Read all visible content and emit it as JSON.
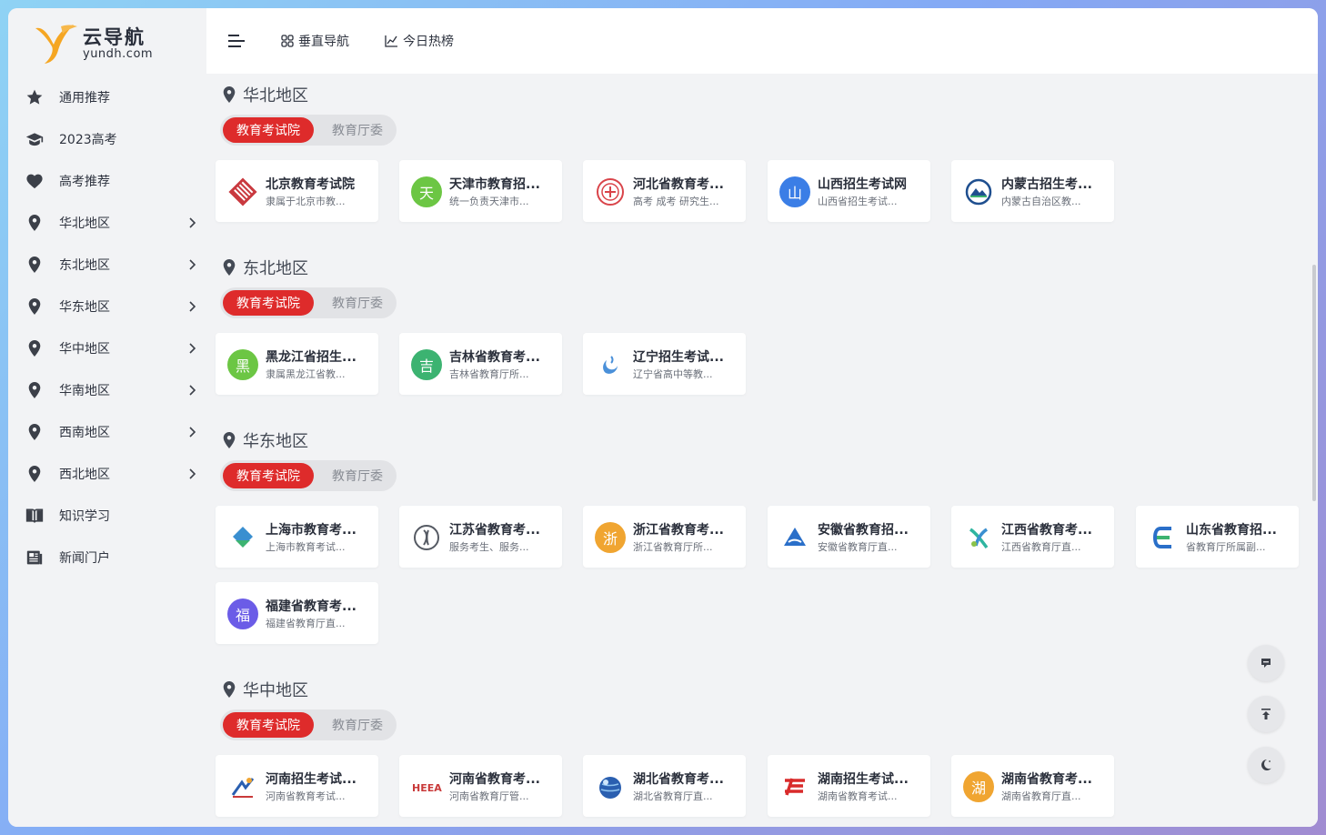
{
  "logo": {
    "title": "云导航",
    "subtitle": "yundh.com"
  },
  "sidebar": {
    "items": [
      {
        "label": "通用推荐",
        "icon": "star-icon",
        "has_arrow": false
      },
      {
        "label": "2023高考",
        "icon": "graduation-cap-icon",
        "has_arrow": false
      },
      {
        "label": "高考推荐",
        "icon": "heart-icon",
        "has_arrow": false
      },
      {
        "label": "华北地区",
        "icon": "map-pin-icon",
        "has_arrow": true
      },
      {
        "label": "东北地区",
        "icon": "map-pin-icon",
        "has_arrow": true
      },
      {
        "label": "华东地区",
        "icon": "map-pin-icon",
        "has_arrow": true
      },
      {
        "label": "华中地区",
        "icon": "map-pin-icon",
        "has_arrow": true
      },
      {
        "label": "华南地区",
        "icon": "map-pin-icon",
        "has_arrow": true
      },
      {
        "label": "西南地区",
        "icon": "map-pin-icon",
        "has_arrow": true
      },
      {
        "label": "西北地区",
        "icon": "map-pin-icon",
        "has_arrow": true
      },
      {
        "label": "知识学习",
        "icon": "book-icon",
        "has_arrow": false
      },
      {
        "label": "新闻门户",
        "icon": "newspaper-icon",
        "has_arrow": false
      }
    ]
  },
  "topbar": {
    "vertical_nav": "垂直导航",
    "hot_today": "今日热榜"
  },
  "tabs": {
    "active": "教育考试院",
    "inactive": "教育厅委"
  },
  "sections": [
    {
      "title": "华北地区",
      "cards": [
        {
          "title": "北京教育考试院",
          "desc": "隶属于北京市教...",
          "icon_text": "",
          "color": "#c9393f"
        },
        {
          "title": "天津市教育招...",
          "desc": "统一负责天津市...",
          "icon_text": "天",
          "color": "#6cc644"
        },
        {
          "title": "河北省教育考...",
          "desc": "高考 成考 研究生...",
          "icon_text": "",
          "color": "#d9444a"
        },
        {
          "title": "山西招生考试网",
          "desc": "山西省招生考试...",
          "icon_text": "山",
          "color": "#3b7ee6"
        },
        {
          "title": "内蒙古招生考...",
          "desc": "内蒙古自治区教...",
          "icon_text": "",
          "color": "#1f4f8f"
        }
      ]
    },
    {
      "title": "东北地区",
      "cards": [
        {
          "title": "黑龙江省招生...",
          "desc": "隶属黑龙江省教...",
          "icon_text": "黑",
          "color": "#6cc644"
        },
        {
          "title": "吉林省教育考...",
          "desc": "吉林省教育厅所...",
          "icon_text": "吉",
          "color": "#3cb371"
        },
        {
          "title": "辽宁招生考试...",
          "desc": "辽宁省高中等教...",
          "icon_text": "",
          "color": "#4a90d9"
        }
      ]
    },
    {
      "title": "华东地区",
      "cards": [
        {
          "title": "上海市教育考...",
          "desc": "上海市教育考试...",
          "icon_text": "",
          "color": "#3a8fd0"
        },
        {
          "title": "江苏省教育考...",
          "desc": "服务考生、服务...",
          "icon_text": "",
          "color": "#555a63"
        },
        {
          "title": "浙江省教育考...",
          "desc": "浙江省教育厅所...",
          "icon_text": "浙",
          "color": "#f0a531"
        },
        {
          "title": "安徽省教育招...",
          "desc": "安徽省教育厅直...",
          "icon_text": "",
          "color": "#2a6fc9"
        },
        {
          "title": "江西省教育考...",
          "desc": "江西省教育厅直...",
          "icon_text": "",
          "color": "#2fb5a0"
        },
        {
          "title": "山东省教育招...",
          "desc": "省教育厅所属副...",
          "icon_text": "",
          "color": "#2a6fc9"
        },
        {
          "title": "福建省教育考...",
          "desc": "福建省教育厅直...",
          "icon_text": "福",
          "color": "#6b5ce7"
        }
      ]
    },
    {
      "title": "华中地区",
      "cards": [
        {
          "title": "河南招生考试...",
          "desc": "河南省教育考试...",
          "icon_text": "",
          "color": "#2a5fb0"
        },
        {
          "title": "河南省教育考...",
          "desc": "河南省教育厅管...",
          "icon_text": "",
          "color": "#c93a3a"
        },
        {
          "title": "湖北省教育考...",
          "desc": "湖北省教育厅直...",
          "icon_text": "",
          "color": "#2a5fb0"
        },
        {
          "title": "湖南招生考试...",
          "desc": "湖南省教育考试...",
          "icon_text": "",
          "color": "#d92b2b"
        },
        {
          "title": "湖南省教育考...",
          "desc": "湖南省教育厅直...",
          "icon_text": "湖",
          "color": "#f0a531"
        }
      ]
    }
  ],
  "colors": {
    "accent": "#de2b2b",
    "background": "#f2f3f5",
    "text": "#2a2f3b"
  }
}
